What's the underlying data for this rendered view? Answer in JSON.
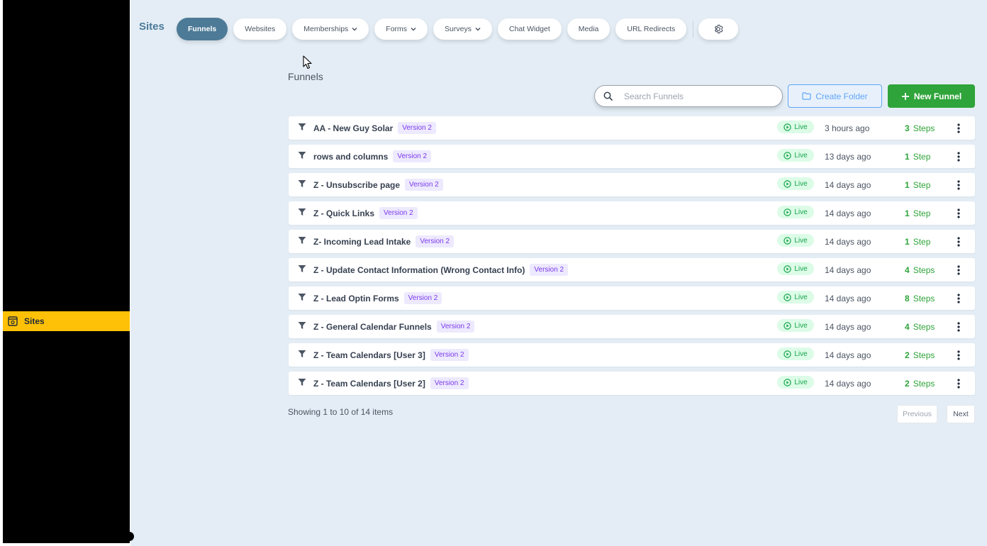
{
  "sidebar": {
    "items": [
      {
        "label": "Sites",
        "icon": "browser-window-icon",
        "active": true
      }
    ]
  },
  "header": {
    "title": "Sites",
    "tabs": [
      {
        "label": "Funnels",
        "active": true,
        "dropdown": false
      },
      {
        "label": "Websites",
        "active": false,
        "dropdown": false
      },
      {
        "label": "Memberships",
        "active": false,
        "dropdown": true
      },
      {
        "label": "Forms",
        "active": false,
        "dropdown": true
      },
      {
        "label": "Surveys",
        "active": false,
        "dropdown": true
      },
      {
        "label": "Chat Widget",
        "active": false,
        "dropdown": false
      },
      {
        "label": "Media",
        "active": false,
        "dropdown": false
      },
      {
        "label": "URL Redirects",
        "active": false,
        "dropdown": false
      }
    ],
    "settings_icon": "gear-icon"
  },
  "main": {
    "section_title": "Funnels",
    "search": {
      "placeholder": "Search Funnels",
      "value": ""
    },
    "create_folder_label": "Create Folder",
    "new_funnel_label": "New Funnel",
    "funnels": [
      {
        "name": "AA - New Guy Solar",
        "version": "Version 2",
        "status": "Live",
        "updated": "3 hours ago",
        "step_count": "3",
        "step_label": "Steps"
      },
      {
        "name": "rows and columns",
        "version": "Version 2",
        "status": "Live",
        "updated": "13 days ago",
        "step_count": "1",
        "step_label": "Step"
      },
      {
        "name": "Z - Unsubscribe page",
        "version": "Version 2",
        "status": "Live",
        "updated": "14 days ago",
        "step_count": "1",
        "step_label": "Step"
      },
      {
        "name": "Z - Quick Links",
        "version": "Version 2",
        "status": "Live",
        "updated": "14 days ago",
        "step_count": "1",
        "step_label": "Step"
      },
      {
        "name": "Z- Incoming Lead Intake",
        "version": "Version 2",
        "status": "Live",
        "updated": "14 days ago",
        "step_count": "1",
        "step_label": "Step"
      },
      {
        "name": "Z - Update Contact Information (Wrong Contact Info)",
        "version": "Version 2",
        "status": "Live",
        "updated": "14 days ago",
        "step_count": "4",
        "step_label": "Steps"
      },
      {
        "name": "Z - Lead Optin Forms",
        "version": "Version 2",
        "status": "Live",
        "updated": "14 days ago",
        "step_count": "8",
        "step_label": "Steps"
      },
      {
        "name": "Z - General Calendar Funnels",
        "version": "Version 2",
        "status": "Live",
        "updated": "14 days ago",
        "step_count": "4",
        "step_label": "Steps"
      },
      {
        "name": "Z - Team Calendars [User 3]",
        "version": "Version 2",
        "status": "Live",
        "updated": "14 days ago",
        "step_count": "2",
        "step_label": "Steps"
      },
      {
        "name": "Z - Team Calendars [User 2]",
        "version": "Version 2",
        "status": "Live",
        "updated": "14 days ago",
        "step_count": "2",
        "step_label": "Steps"
      }
    ],
    "pagination": {
      "summary": "Showing 1 to 10 of 14 items",
      "previous_label": "Previous",
      "next_label": "Next"
    }
  },
  "colors": {
    "accent": "#4d7a96",
    "primary_green": "#2ea43a",
    "sidebar_active": "#ffc107",
    "version_badge": "#7c3aed",
    "background": "#e4edf5"
  }
}
